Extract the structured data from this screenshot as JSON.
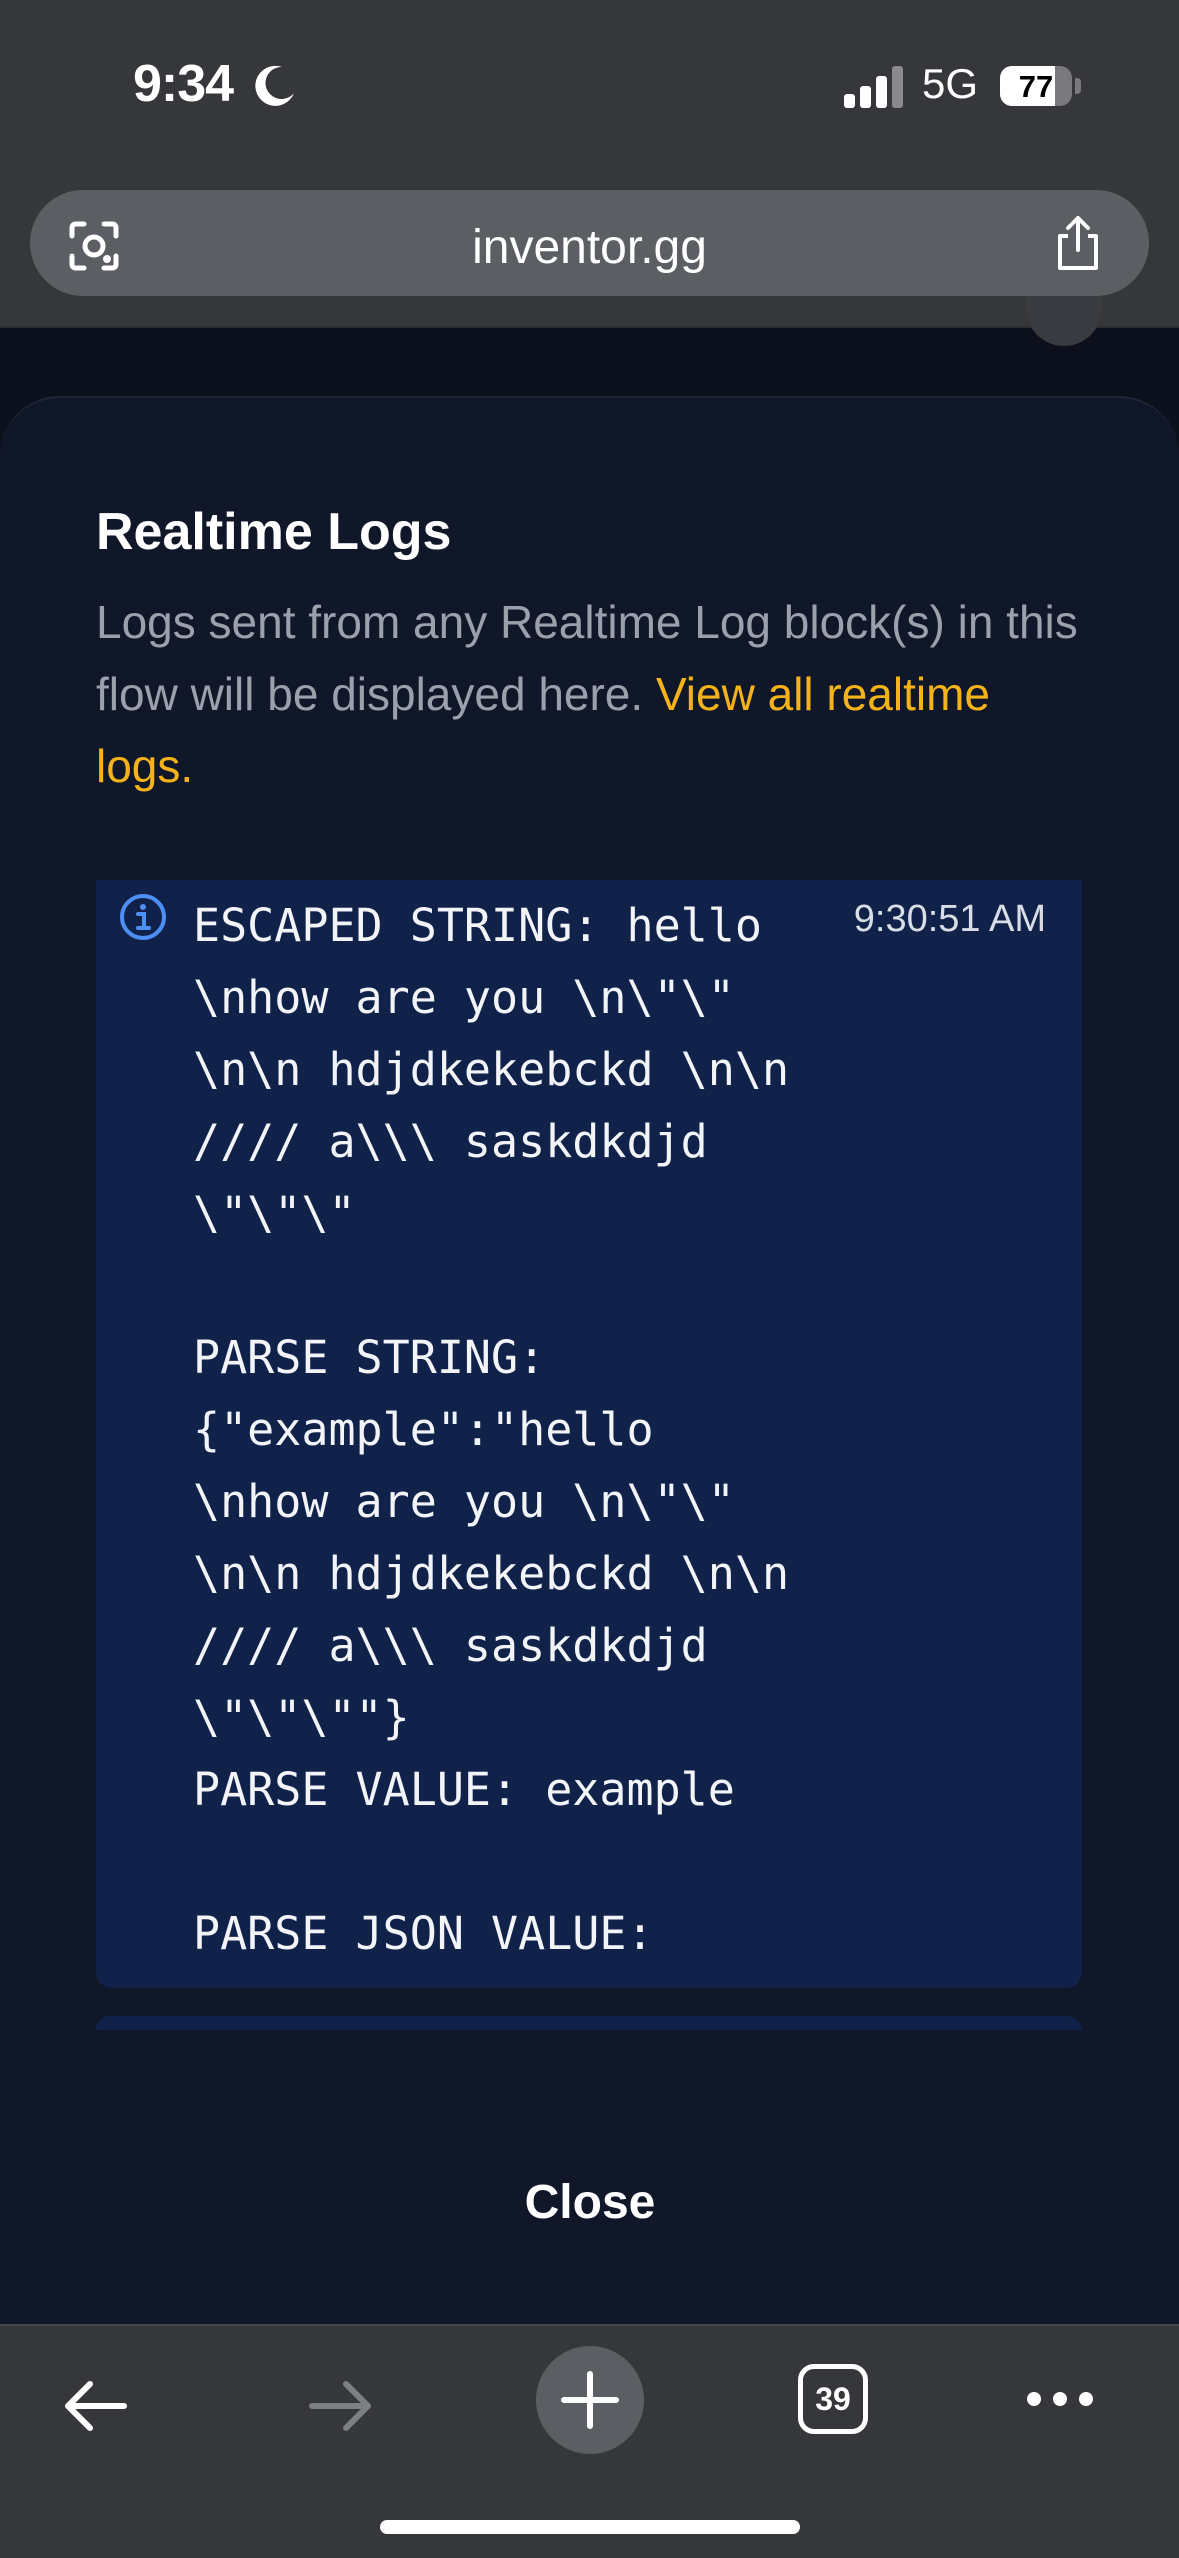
{
  "status_bar": {
    "time": "9:34",
    "network": "5G",
    "battery_percent": "77",
    "battery_level": 0.77
  },
  "browser": {
    "url": "inventor.gg",
    "open_tabs": "39"
  },
  "modal": {
    "title": "Realtime Logs",
    "description": "Logs sent from any Realtime Log block(s) in this flow will be displayed here.",
    "description_link": "View all realtime logs.",
    "log_entry": {
      "timestamp": "9:30:51 AM",
      "text": "ESCAPED STRING: hello\n\\nhow are you \\n\\\"\\\"\n\\n\\n hdjdkekebckd \\n\\n\n//// a\\\\\\ saskdkdjd\n\\\"\\\"\\\"\n\nPARSE STRING:\n{\"example\":\"hello\n\\nhow are you \\n\\\"\\\"\n\\n\\n hdjdkekebckd \\n\\n\n//// a\\\\\\ saskdkdjd\n\\\"\\\"\\\"\"}\nPARSE VALUE: example\n\nPARSE JSON VALUE:"
    },
    "close_label": "Close"
  },
  "colors": {
    "accent_link": "#f5b319",
    "log_background": "#10224a",
    "info_icon": "#4e8ff5"
  }
}
